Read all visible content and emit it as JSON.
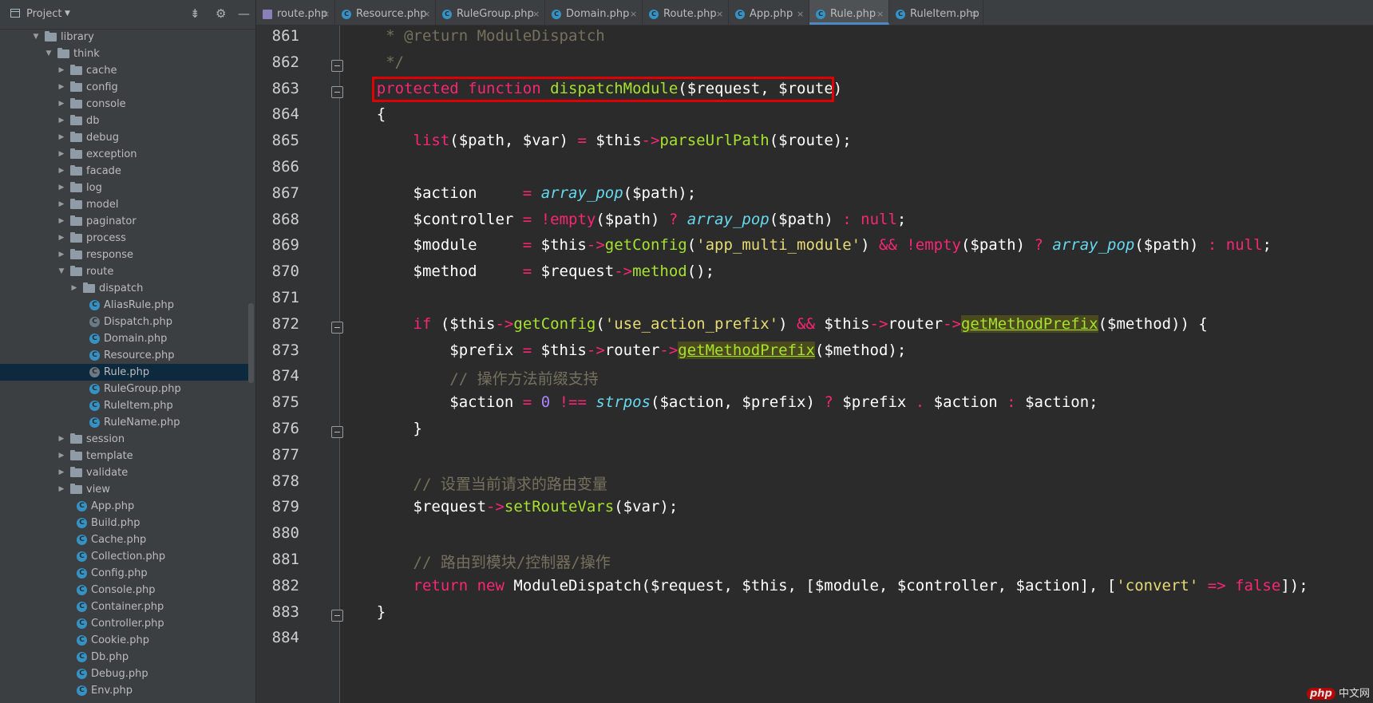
{
  "sidebar": {
    "header": {
      "title": "Project"
    },
    "tree": [
      {
        "label": "library",
        "kind": "folder",
        "depth": 2,
        "expanded": true
      },
      {
        "label": "think",
        "kind": "folder",
        "depth": 3,
        "expanded": true
      },
      {
        "label": "cache",
        "kind": "folder",
        "depth": 4,
        "expanded": false
      },
      {
        "label": "config",
        "kind": "folder",
        "depth": 4,
        "expanded": false
      },
      {
        "label": "console",
        "kind": "folder",
        "depth": 4,
        "expanded": false
      },
      {
        "label": "db",
        "kind": "folder",
        "depth": 4,
        "expanded": false
      },
      {
        "label": "debug",
        "kind": "folder",
        "depth": 4,
        "expanded": false
      },
      {
        "label": "exception",
        "kind": "folder",
        "depth": 4,
        "expanded": false
      },
      {
        "label": "facade",
        "kind": "folder",
        "depth": 4,
        "expanded": false
      },
      {
        "label": "log",
        "kind": "folder",
        "depth": 4,
        "expanded": false
      },
      {
        "label": "model",
        "kind": "folder",
        "depth": 4,
        "expanded": false
      },
      {
        "label": "paginator",
        "kind": "folder",
        "depth": 4,
        "expanded": false
      },
      {
        "label": "process",
        "kind": "folder",
        "depth": 4,
        "expanded": false
      },
      {
        "label": "response",
        "kind": "folder",
        "depth": 4,
        "expanded": false
      },
      {
        "label": "route",
        "kind": "folder",
        "depth": 4,
        "expanded": true
      },
      {
        "label": "dispatch",
        "kind": "folder",
        "depth": 5,
        "expanded": false
      },
      {
        "label": "AliasRule.php",
        "kind": "class",
        "depth": 5
      },
      {
        "label": "Dispatch.php",
        "kind": "abstract",
        "depth": 5
      },
      {
        "label": "Domain.php",
        "kind": "class",
        "depth": 5
      },
      {
        "label": "Resource.php",
        "kind": "class",
        "depth": 5
      },
      {
        "label": "Rule.php",
        "kind": "abstract",
        "depth": 5,
        "selected": true
      },
      {
        "label": "RuleGroup.php",
        "kind": "class",
        "depth": 5
      },
      {
        "label": "RuleItem.php",
        "kind": "class",
        "depth": 5
      },
      {
        "label": "RuleName.php",
        "kind": "class",
        "depth": 5
      },
      {
        "label": "session",
        "kind": "folder",
        "depth": 4,
        "expanded": false
      },
      {
        "label": "template",
        "kind": "folder",
        "depth": 4,
        "expanded": false
      },
      {
        "label": "validate",
        "kind": "folder",
        "depth": 4,
        "expanded": false
      },
      {
        "label": "view",
        "kind": "folder",
        "depth": 4,
        "expanded": false
      },
      {
        "label": "App.php",
        "kind": "class",
        "depth": 4
      },
      {
        "label": "Build.php",
        "kind": "class",
        "depth": 4
      },
      {
        "label": "Cache.php",
        "kind": "class",
        "depth": 4
      },
      {
        "label": "Collection.php",
        "kind": "class",
        "depth": 4
      },
      {
        "label": "Config.php",
        "kind": "class",
        "depth": 4
      },
      {
        "label": "Console.php",
        "kind": "class",
        "depth": 4
      },
      {
        "label": "Container.php",
        "kind": "class",
        "depth": 4
      },
      {
        "label": "Controller.php",
        "kind": "class",
        "depth": 4
      },
      {
        "label": "Cookie.php",
        "kind": "class",
        "depth": 4
      },
      {
        "label": "Db.php",
        "kind": "class",
        "depth": 4
      },
      {
        "label": "Debug.php",
        "kind": "class",
        "depth": 4
      },
      {
        "label": "Env.php",
        "kind": "class",
        "depth": 4
      }
    ]
  },
  "tabs": [
    {
      "label": "route.php",
      "icon": "php-file-icon",
      "active": false
    },
    {
      "label": "Resource.php",
      "icon": "class-icon",
      "active": false
    },
    {
      "label": "RuleGroup.php",
      "icon": "class-icon",
      "active": false
    },
    {
      "label": "Domain.php",
      "icon": "class-icon",
      "active": false
    },
    {
      "label": "Route.php",
      "icon": "class-icon",
      "active": false
    },
    {
      "label": "App.php",
      "icon": "class-icon",
      "active": false
    },
    {
      "label": "Rule.php",
      "icon": "abstract-class-icon",
      "active": true
    },
    {
      "label": "RuleItem.php",
      "icon": "class-icon",
      "active": false
    }
  ],
  "tab_close_glyph": "×",
  "editor": {
    "lines": [
      {
        "num": "861",
        "fold": false,
        "html": "<span class=\"cm\">     * @return ModuleDispatch</span>"
      },
      {
        "num": "862",
        "fold": true,
        "html": "<span class=\"cm\">     */</span>"
      },
      {
        "num": "863",
        "fold": true,
        "html": "    <span class=\"kw\">protected</span> <span class=\"kw\">function</span> <span class=\"fn\">dispatchModule</span>($request, $route)"
      },
      {
        "num": "864",
        "fold": false,
        "html": "    {"
      },
      {
        "num": "865",
        "fold": false,
        "html": "        <span class=\"kw\">list</span>($path, $var) <span class=\"op\">=</span> $this<span class=\"op\">-&gt;</span><span class=\"fn\">parseUrlPath</span>($route);"
      },
      {
        "num": "866",
        "fold": false,
        "html": ""
      },
      {
        "num": "867",
        "fold": false,
        "html": "        $action     <span class=\"op\">=</span> <span class=\"it\">array_pop</span>($path);"
      },
      {
        "num": "868",
        "fold": false,
        "html": "        $controller <span class=\"op\">=</span> <span class=\"op\">!</span><span class=\"kw\">empty</span>($path) <span class=\"op\">?</span> <span class=\"it\">array_pop</span>($path) <span class=\"op\">:</span> <span class=\"nl\">null</span>;"
      },
      {
        "num": "869",
        "fold": false,
        "html": "        $module     <span class=\"op\">=</span> $this<span class=\"op\">-&gt;</span><span class=\"fn\">getConfig</span>(<span class=\"str\">'app_multi_module'</span>) <span class=\"op\">&amp;&amp;</span> <span class=\"op\">!</span><span class=\"kw\">empty</span>($path) <span class=\"op\">?</span> <span class=\"it\">array_pop</span>($path) <span class=\"op\">:</span> <span class=\"nl\">null</span>;"
      },
      {
        "num": "870",
        "fold": false,
        "html": "        $method     <span class=\"op\">=</span> $request<span class=\"op\">-&gt;</span><span class=\"fn\">method</span>();"
      },
      {
        "num": "871",
        "fold": false,
        "html": ""
      },
      {
        "num": "872",
        "fold": true,
        "html": "        <span class=\"kw\">if</span> ($this<span class=\"op\">-&gt;</span><span class=\"fn\">getConfig</span>(<span class=\"str\">'use_action_prefix'</span>) <span class=\"op\">&amp;&amp;</span> $this<span class=\"op\">-&gt;</span>router<span class=\"op\">-&gt;</span><span class=\"fn hl ul\">getMethodPrefix</span>($method)) {"
      },
      {
        "num": "873",
        "fold": false,
        "html": "            $prefix <span class=\"op\">=</span> $this<span class=\"op\">-&gt;</span>router<span class=\"op\">-&gt;</span><span class=\"fn hl ul\">getMethodPrefix</span>($method);"
      },
      {
        "num": "874",
        "fold": false,
        "html": "<span class=\"cm\">            // 操作方法前缀支持</span>"
      },
      {
        "num": "875",
        "fold": false,
        "html": "            $action <span class=\"op\">=</span> <span class=\"num\">0</span> <span class=\"op\">!==</span> <span class=\"it\">strpos</span>($action, $prefix) <span class=\"op\">?</span> $prefix <span class=\"op\">.</span> $action <span class=\"op\">:</span> $action;"
      },
      {
        "num": "876",
        "fold": true,
        "html": "        }"
      },
      {
        "num": "877",
        "fold": false,
        "html": ""
      },
      {
        "num": "878",
        "fold": false,
        "html": "<span class=\"cm\">        // 设置当前请求的路由变量</span>"
      },
      {
        "num": "879",
        "fold": false,
        "html": "        $request<span class=\"op\">-&gt;</span><span class=\"fn\">setRouteVars</span>($var);"
      },
      {
        "num": "880",
        "fold": false,
        "html": ""
      },
      {
        "num": "881",
        "fold": false,
        "html": "<span class=\"cm\">        // 路由到模块/控制器/操作</span>"
      },
      {
        "num": "882",
        "fold": false,
        "html": "        <span class=\"kw\">return</span> <span class=\"kw\">new</span> ModuleDispatch($request, $this, [$module, $controller, $action], [<span class=\"str\">'convert'</span> <span class=\"op\">=&gt;</span> <span class=\"nl\">false</span>]);"
      },
      {
        "num": "883",
        "fold": true,
        "html": "    }"
      },
      {
        "num": "884",
        "fold": false,
        "html": ""
      }
    ]
  },
  "watermark": {
    "brand": "php",
    "site": "中文网"
  },
  "colors": {
    "accent": "#4a88c7",
    "highlight_box": "#e00000",
    "keyword": "#f92672",
    "function": "#a6e22e"
  }
}
